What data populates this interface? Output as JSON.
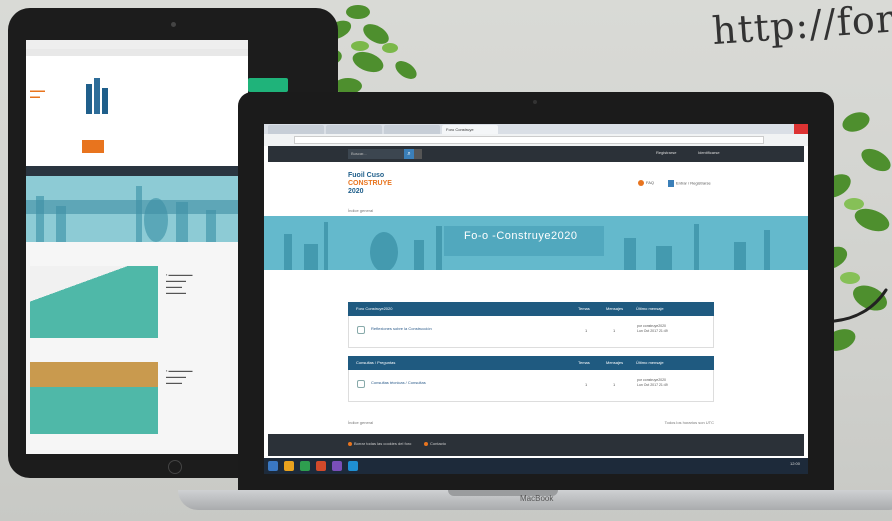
{
  "scene": {
    "url_handwriting": "http://foro",
    "laptop_brand": "MacBook"
  },
  "tablet": {
    "nav_items": [
      "",
      "",
      ""
    ]
  },
  "laptop": {
    "browser": {
      "tabs": [
        "",
        "",
        "",
        "Foro Construye"
      ],
      "address": ""
    },
    "forum": {
      "search_placeholder": "Buscar...",
      "top_links": [
        "Registrarse",
        "Identificarse"
      ],
      "logo_lines": [
        "Fuoil Cuso",
        "CONSTRUYE",
        "2020"
      ],
      "header_links": [
        "FAQ",
        "Entrar / Registrarse"
      ],
      "breadcrumb": "Índice general",
      "banner_title": "Fo-o  -Construye2020",
      "banner_subtitle": "",
      "sections": [
        {
          "heading": "Foro Construye2020",
          "columns": [
            "Temas",
            "Mensajes",
            "Último mensaje"
          ],
          "rows": [
            {
              "title": "Reflexiones sobre la Construcción",
              "topics": "1",
              "posts": "1",
              "last": [
                "por construye2020",
                "Lun Oct 2017 21:49"
              ]
            }
          ]
        },
        {
          "heading": "Consultas / Preguntas",
          "columns": [
            "Temas",
            "Mensajes",
            "Último mensaje"
          ],
          "rows": [
            {
              "title": "Consultas técnicas / Consultas",
              "topics": "1",
              "posts": "1",
              "last": [
                "por construye2020",
                "Lun Oct 2017 21:49"
              ]
            }
          ]
        }
      ],
      "footer_left": "Índice general",
      "footer_right": "Todos los horarios son UTC",
      "footer_links": [
        "Borrar todas las cookies del foro",
        "Contacto"
      ]
    },
    "taskbar_time": "12:00"
  }
}
